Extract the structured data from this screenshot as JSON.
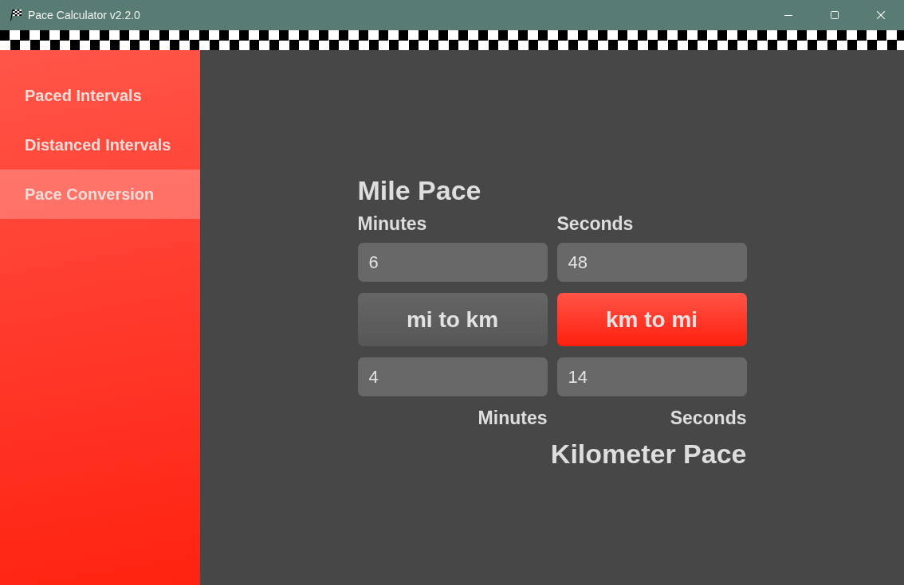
{
  "window": {
    "title": "Pace Calculator v2.2.0"
  },
  "sidebar": {
    "items": [
      {
        "label": "Paced Intervals",
        "selected": false
      },
      {
        "label": "Distanced Intervals",
        "selected": false
      },
      {
        "label": "Pace Conversion",
        "selected": true
      }
    ]
  },
  "mile_pace": {
    "heading": "Mile Pace",
    "labels": [
      "Minutes",
      "Seconds"
    ],
    "fields": [
      {
        "value": "6"
      },
      {
        "value": "48"
      }
    ]
  },
  "buttons": [
    {
      "label": "mi to km",
      "selected": false
    },
    {
      "label": "km to mi",
      "selected": true
    }
  ],
  "kilometer_pace": {
    "fields": [
      {
        "value": "4"
      },
      {
        "value": "14"
      }
    ],
    "labels": [
      "Minutes",
      "Seconds"
    ],
    "heading": "Kilometer Pace"
  }
}
